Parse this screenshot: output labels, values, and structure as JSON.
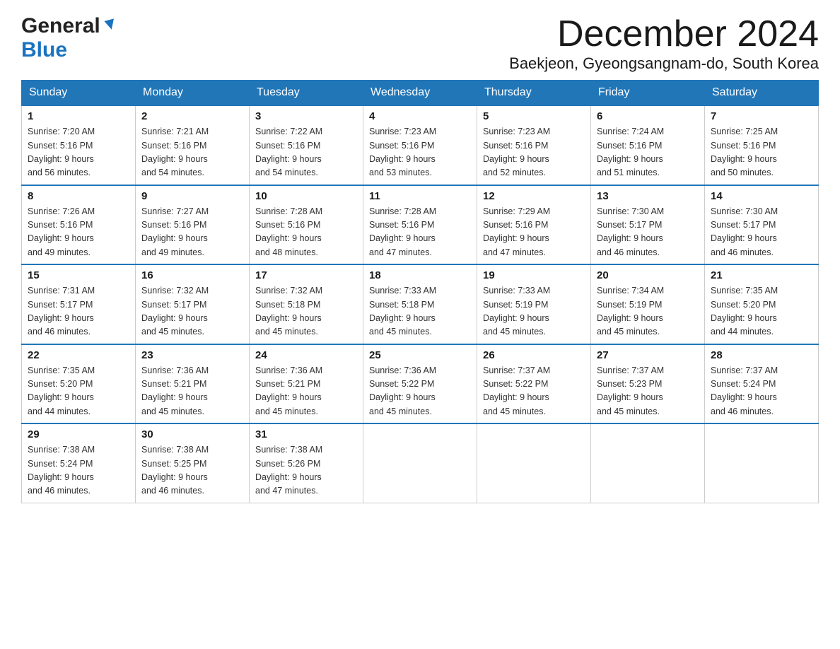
{
  "header": {
    "logo_general": "General",
    "logo_blue": "Blue",
    "month_title": "December 2024",
    "location": "Baekjeon, Gyeongsangnam-do, South Korea"
  },
  "days_of_week": [
    "Sunday",
    "Monday",
    "Tuesday",
    "Wednesday",
    "Thursday",
    "Friday",
    "Saturday"
  ],
  "weeks": [
    [
      {
        "day": "1",
        "sunrise": "7:20 AM",
        "sunset": "5:16 PM",
        "daylight": "9 hours and 56 minutes."
      },
      {
        "day": "2",
        "sunrise": "7:21 AM",
        "sunset": "5:16 PM",
        "daylight": "9 hours and 54 minutes."
      },
      {
        "day": "3",
        "sunrise": "7:22 AM",
        "sunset": "5:16 PM",
        "daylight": "9 hours and 54 minutes."
      },
      {
        "day": "4",
        "sunrise": "7:23 AM",
        "sunset": "5:16 PM",
        "daylight": "9 hours and 53 minutes."
      },
      {
        "day": "5",
        "sunrise": "7:23 AM",
        "sunset": "5:16 PM",
        "daylight": "9 hours and 52 minutes."
      },
      {
        "day": "6",
        "sunrise": "7:24 AM",
        "sunset": "5:16 PM",
        "daylight": "9 hours and 51 minutes."
      },
      {
        "day": "7",
        "sunrise": "7:25 AM",
        "sunset": "5:16 PM",
        "daylight": "9 hours and 50 minutes."
      }
    ],
    [
      {
        "day": "8",
        "sunrise": "7:26 AM",
        "sunset": "5:16 PM",
        "daylight": "9 hours and 49 minutes."
      },
      {
        "day": "9",
        "sunrise": "7:27 AM",
        "sunset": "5:16 PM",
        "daylight": "9 hours and 49 minutes."
      },
      {
        "day": "10",
        "sunrise": "7:28 AM",
        "sunset": "5:16 PM",
        "daylight": "9 hours and 48 minutes."
      },
      {
        "day": "11",
        "sunrise": "7:28 AM",
        "sunset": "5:16 PM",
        "daylight": "9 hours and 47 minutes."
      },
      {
        "day": "12",
        "sunrise": "7:29 AM",
        "sunset": "5:16 PM",
        "daylight": "9 hours and 47 minutes."
      },
      {
        "day": "13",
        "sunrise": "7:30 AM",
        "sunset": "5:17 PM",
        "daylight": "9 hours and 46 minutes."
      },
      {
        "day": "14",
        "sunrise": "7:30 AM",
        "sunset": "5:17 PM",
        "daylight": "9 hours and 46 minutes."
      }
    ],
    [
      {
        "day": "15",
        "sunrise": "7:31 AM",
        "sunset": "5:17 PM",
        "daylight": "9 hours and 46 minutes."
      },
      {
        "day": "16",
        "sunrise": "7:32 AM",
        "sunset": "5:17 PM",
        "daylight": "9 hours and 45 minutes."
      },
      {
        "day": "17",
        "sunrise": "7:32 AM",
        "sunset": "5:18 PM",
        "daylight": "9 hours and 45 minutes."
      },
      {
        "day": "18",
        "sunrise": "7:33 AM",
        "sunset": "5:18 PM",
        "daylight": "9 hours and 45 minutes."
      },
      {
        "day": "19",
        "sunrise": "7:33 AM",
        "sunset": "5:19 PM",
        "daylight": "9 hours and 45 minutes."
      },
      {
        "day": "20",
        "sunrise": "7:34 AM",
        "sunset": "5:19 PM",
        "daylight": "9 hours and 45 minutes."
      },
      {
        "day": "21",
        "sunrise": "7:35 AM",
        "sunset": "5:20 PM",
        "daylight": "9 hours and 44 minutes."
      }
    ],
    [
      {
        "day": "22",
        "sunrise": "7:35 AM",
        "sunset": "5:20 PM",
        "daylight": "9 hours and 44 minutes."
      },
      {
        "day": "23",
        "sunrise": "7:36 AM",
        "sunset": "5:21 PM",
        "daylight": "9 hours and 45 minutes."
      },
      {
        "day": "24",
        "sunrise": "7:36 AM",
        "sunset": "5:21 PM",
        "daylight": "9 hours and 45 minutes."
      },
      {
        "day": "25",
        "sunrise": "7:36 AM",
        "sunset": "5:22 PM",
        "daylight": "9 hours and 45 minutes."
      },
      {
        "day": "26",
        "sunrise": "7:37 AM",
        "sunset": "5:22 PM",
        "daylight": "9 hours and 45 minutes."
      },
      {
        "day": "27",
        "sunrise": "7:37 AM",
        "sunset": "5:23 PM",
        "daylight": "9 hours and 45 minutes."
      },
      {
        "day": "28",
        "sunrise": "7:37 AM",
        "sunset": "5:24 PM",
        "daylight": "9 hours and 46 minutes."
      }
    ],
    [
      {
        "day": "29",
        "sunrise": "7:38 AM",
        "sunset": "5:24 PM",
        "daylight": "9 hours and 46 minutes."
      },
      {
        "day": "30",
        "sunrise": "7:38 AM",
        "sunset": "5:25 PM",
        "daylight": "9 hours and 46 minutes."
      },
      {
        "day": "31",
        "sunrise": "7:38 AM",
        "sunset": "5:26 PM",
        "daylight": "9 hours and 47 minutes."
      },
      null,
      null,
      null,
      null
    ]
  ],
  "labels": {
    "sunrise_prefix": "Sunrise: ",
    "sunset_prefix": "Sunset: ",
    "daylight_prefix": "Daylight: "
  }
}
